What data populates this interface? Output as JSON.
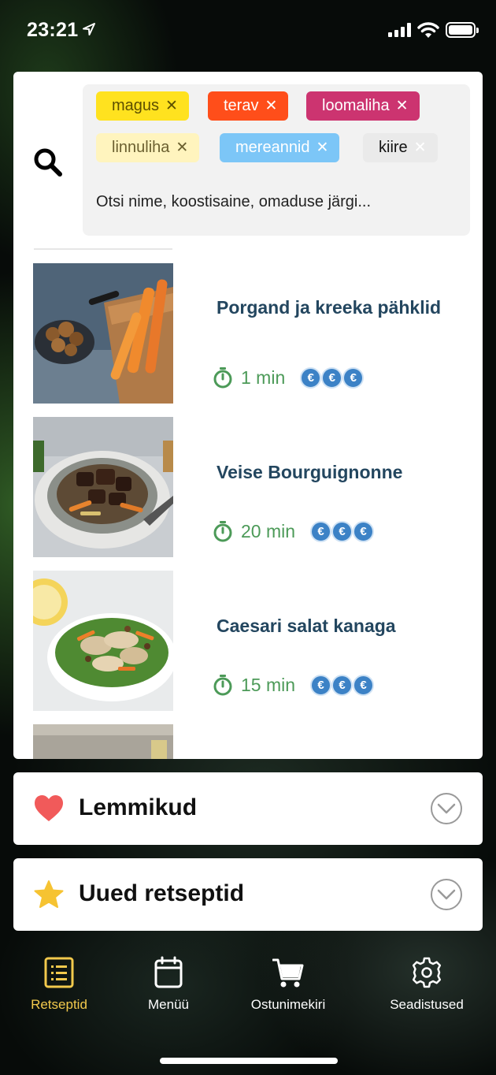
{
  "status_bar": {
    "time": "23:21"
  },
  "search": {
    "placeholder": "Otsi nime, koostisaine, omaduse järgi...",
    "tags": [
      {
        "label": "magus",
        "color": "#ffe21f",
        "text_color": "#5c4f00"
      },
      {
        "label": "terav",
        "color": "#ff4e1a",
        "text_color": "#ffffff"
      },
      {
        "label": "loomaliha",
        "color": "#cc3470",
        "text_color": "#ffffff"
      },
      {
        "label": "linnuliha",
        "color": "#fff4be",
        "text_color": "#6b6030"
      },
      {
        "label": "mereannid",
        "color": "#7cc6f7",
        "text_color": "#ffffff"
      },
      {
        "label": "kiire",
        "color": "#eaeaea",
        "text_color": "#111111"
      }
    ]
  },
  "recipes": [
    {
      "title": "Porgand ja kreeka pähklid",
      "time": "1 min",
      "price_level": 3,
      "currency_symbol": "€"
    },
    {
      "title": "Veise Bourguignonne",
      "time": "20 min",
      "price_level": 3,
      "currency_symbol": "€"
    },
    {
      "title": "Caesari salat kanaga",
      "time": "15 min",
      "price_level": 3,
      "currency_symbol": "€"
    }
  ],
  "sections": {
    "favorites": {
      "title": "Lemmikud",
      "icon": "heart-icon",
      "icon_color": "#f15a5a"
    },
    "new_recipes": {
      "title": "Uued retseptid",
      "icon": "star-icon",
      "icon_color": "#f6c332"
    }
  },
  "tabs": [
    {
      "label": "Retseptid",
      "icon": "list-icon",
      "active": true
    },
    {
      "label": "Menüü",
      "icon": "calendar-icon",
      "active": false
    },
    {
      "label": "Ostunimekiri",
      "icon": "cart-icon",
      "active": false
    },
    {
      "label": "Seadistused",
      "icon": "gear-icon",
      "active": false
    }
  ],
  "colors": {
    "active_tab": "#f2c94c",
    "recipe_title": "#23465f",
    "time_green": "#4c9a58",
    "euro_blue": "#3c82c6"
  }
}
